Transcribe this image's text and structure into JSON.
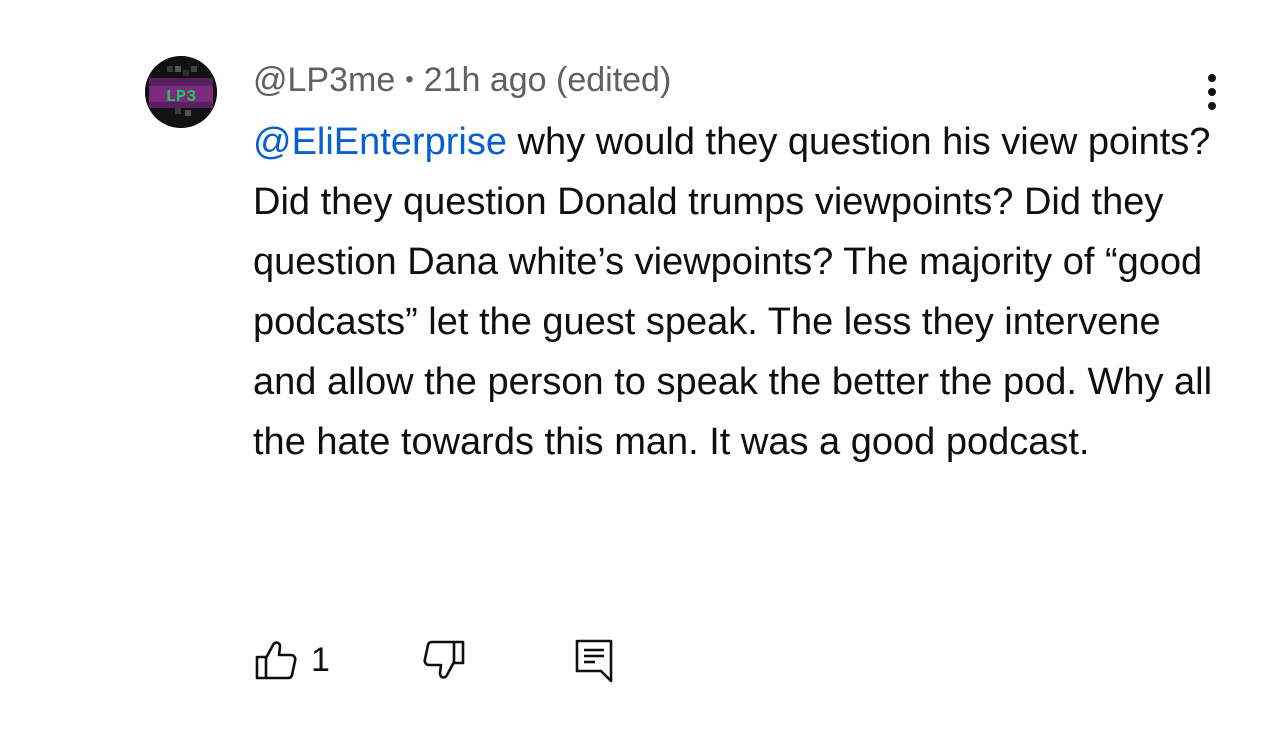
{
  "comment": {
    "author": "@LP3me",
    "separator": "•",
    "timestamp": "21h ago (edited)",
    "mention": "@EliEnterprise",
    "text": " why would they question his view points? Did they question Donald trumps viewpoints? Did they question Dana white’s viewpoints? The majority of “good podcasts” let the guest speak. The less they intervene and allow the person to speak the better the pod. Why all the hate towards this man. It was a good podcast.",
    "avatar_text": "LP3",
    "avatar_icon": "lp3-logo-avatar",
    "like_count": "1"
  },
  "icons": {
    "more": "more-vert-icon",
    "like": "thumbs-up-icon",
    "dislike": "thumbs-down-icon",
    "reply": "reply-comment-icon"
  },
  "colors": {
    "mention": "#065fd4",
    "meta_text": "#606060",
    "body_text": "#0f0f0f",
    "avatar_background": "#121212",
    "avatar_accent": "#22c55e",
    "avatar_purple": "#7b2a7f"
  }
}
